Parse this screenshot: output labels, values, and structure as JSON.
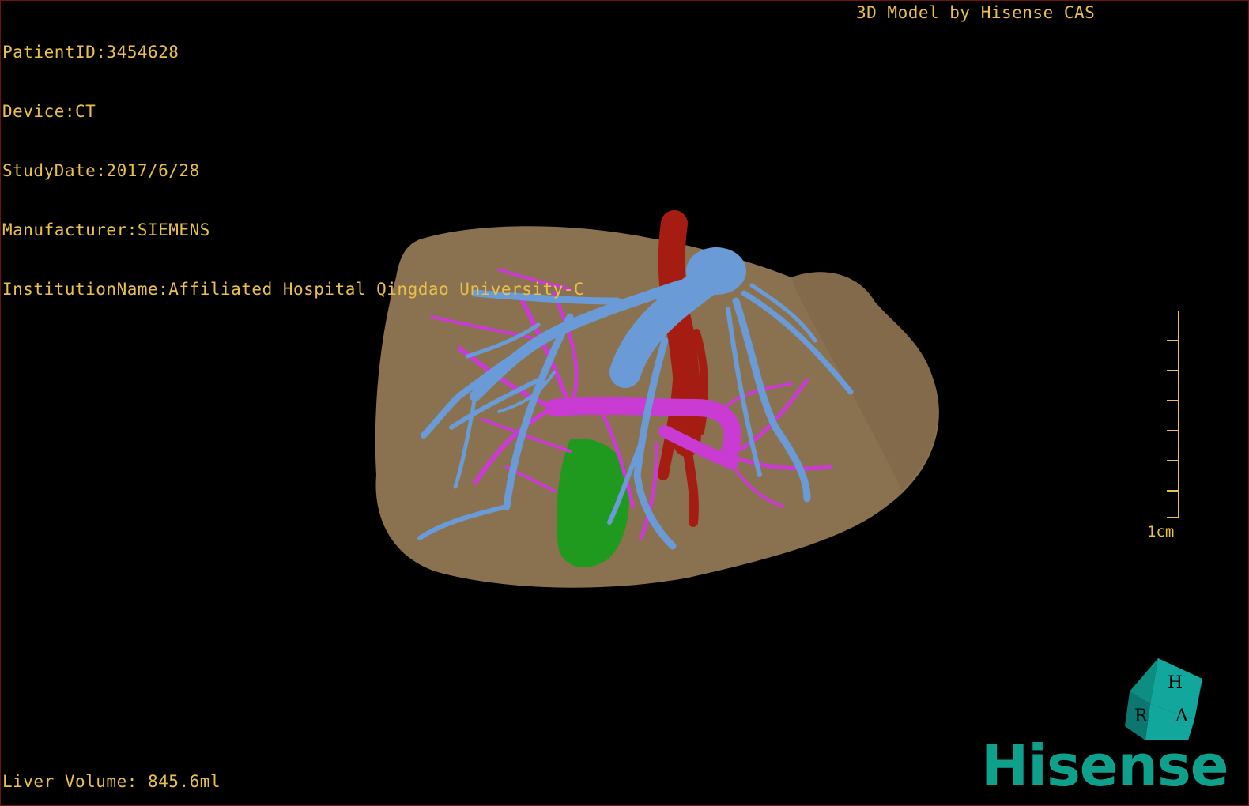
{
  "patient_info": {
    "patient_id": "PatientID:3454628",
    "device": "Device:CT",
    "study_date": "StudyDate:2017/6/28",
    "manufacturer": "Manufacturer:SIEMENS",
    "institution": "InstitutionName:Affiliated Hospital Qingdao University-C"
  },
  "model_caption": "3D Model by Hisense CAS",
  "liver_volume": "Liver Volume: 845.6ml",
  "scale_bar": {
    "label": "1cm"
  },
  "orientation_cube": {
    "faces": [
      "H",
      "A",
      "R"
    ],
    "icon": "orientation-cube-icon"
  },
  "logo": {
    "text": "Hisense"
  },
  "model": {
    "structures": [
      "liver",
      "hepatic-veins",
      "portal-veins",
      "artery",
      "gallbladder"
    ]
  },
  "colors": {
    "text": "#e9c14a",
    "liver": "#8a7150",
    "hepatic_vein": "#6b9bd6",
    "portal_vein": "#c93bd2",
    "artery": "#a51c12",
    "gallbladder": "#1f9a1f",
    "logo": "#0fa08b",
    "border": "#6e1212"
  }
}
